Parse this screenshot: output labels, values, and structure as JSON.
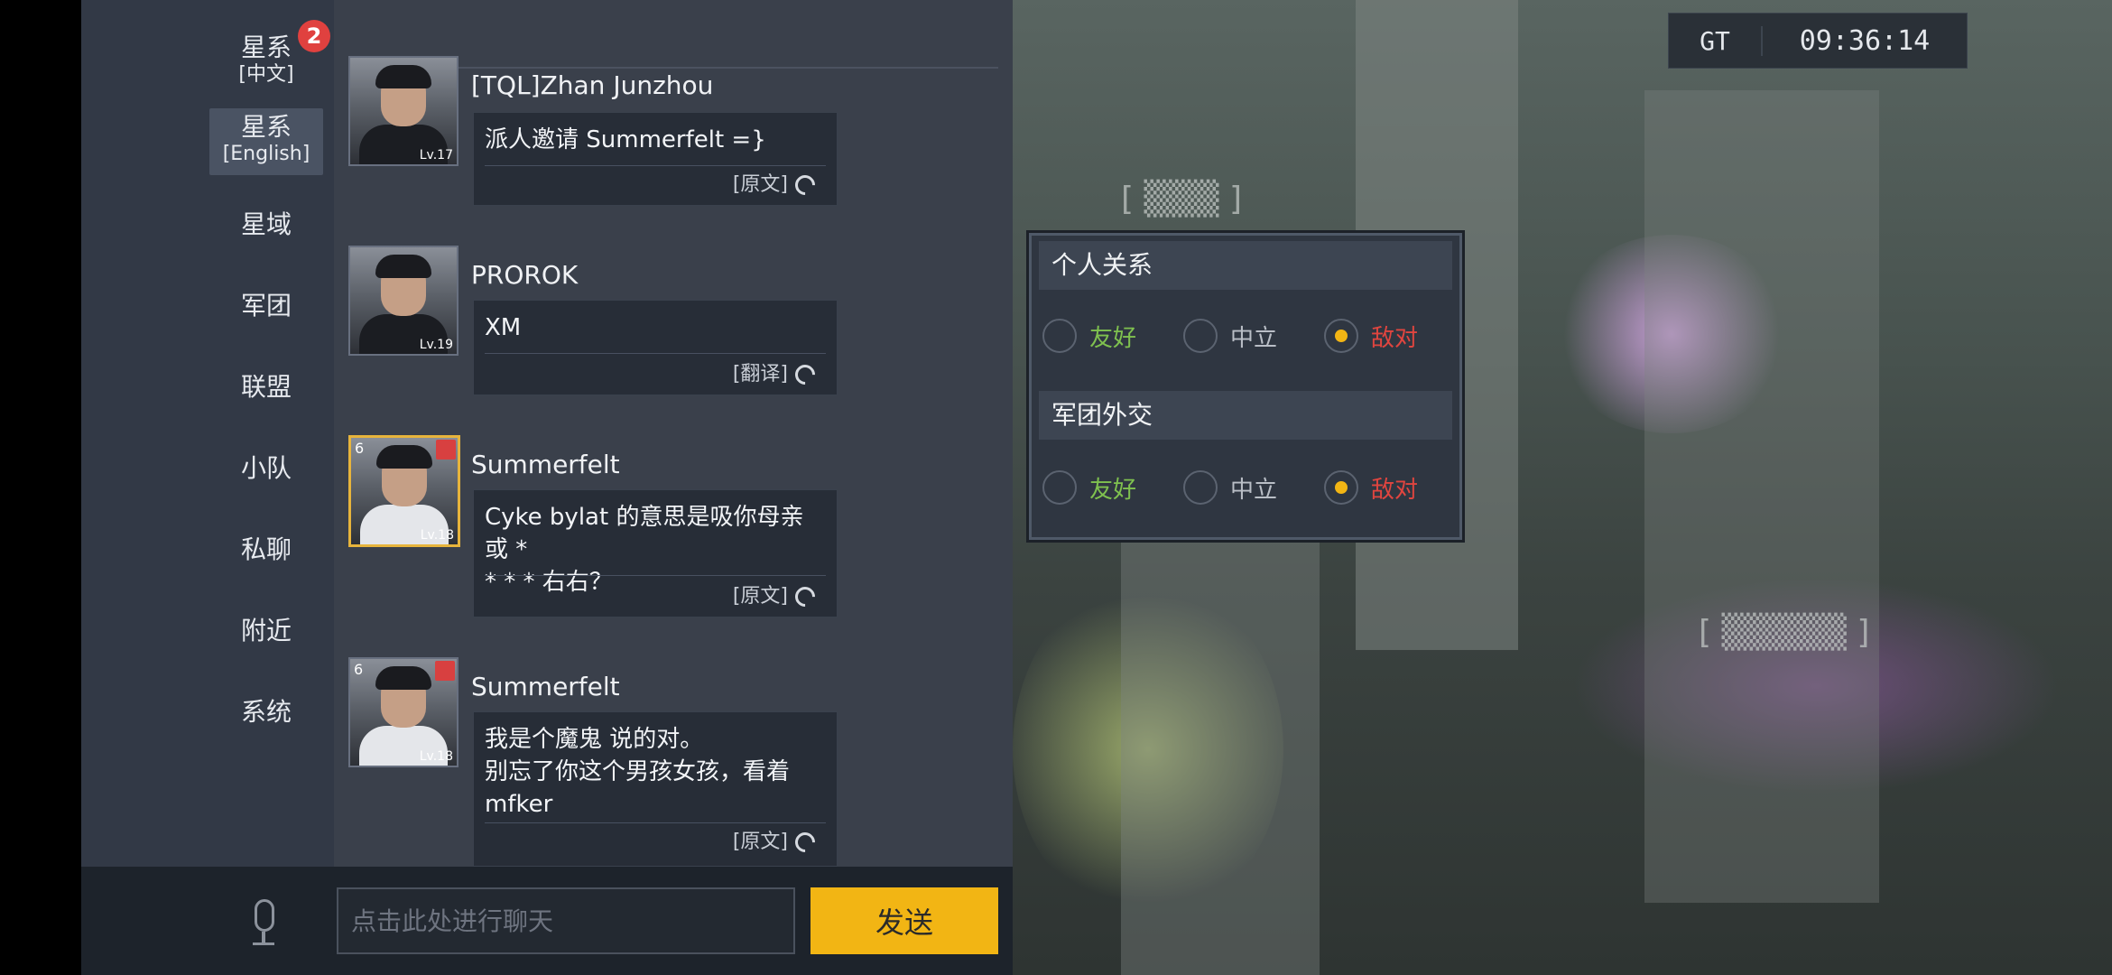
{
  "sidebar": {
    "tabs": [
      {
        "label": "星系",
        "sub": "[中文]"
      },
      {
        "label": "星系",
        "sub": "[English]"
      },
      {
        "label": "星域"
      },
      {
        "label": "军团"
      },
      {
        "label": "联盟"
      },
      {
        "label": "小队"
      },
      {
        "label": "私聊"
      },
      {
        "label": "附近"
      },
      {
        "label": "系统"
      }
    ],
    "badge": "2"
  },
  "messages": [
    {
      "name": "[TQL]Zhan Junzhou",
      "level": "Lv.17",
      "text": "派人邀请 Summerfelt =}",
      "action": "[原文]"
    },
    {
      "name": "PROROK",
      "level": "Lv.19",
      "text": "XM",
      "action": "[翻译]"
    },
    {
      "name": "Summerfelt",
      "level": "Lv.18",
      "rank": "6",
      "text1": "Cyke bylat 的意思是吸你母亲或 *",
      "text2": "* * * 右右？",
      "action": "[原文]"
    },
    {
      "name": "Summerfelt",
      "level": "Lv.18",
      "rank": "6",
      "text1": "我是个魔鬼 说的对。",
      "text2": "别忘了你这个男孩女孩，看着",
      "text3": "mfker",
      "action": "[原文]"
    }
  ],
  "input": {
    "placeholder": "点击此处进行聊天",
    "send_label": "发送"
  },
  "clock": {
    "zone": "GT",
    "time": "09:36:14"
  },
  "relations": {
    "personal": {
      "title": "个人关系",
      "options": [
        "友好",
        "中立",
        "敌对"
      ],
      "selected": "敌对"
    },
    "corp": {
      "title": "军团外交",
      "options": [
        "友好",
        "中立",
        "敌对"
      ],
      "selected": "敌对"
    }
  },
  "colors": {
    "accent": "#f2b514",
    "friendly": "#7fc14f",
    "hostile": "#e0453f",
    "badge": "#e0413f"
  }
}
